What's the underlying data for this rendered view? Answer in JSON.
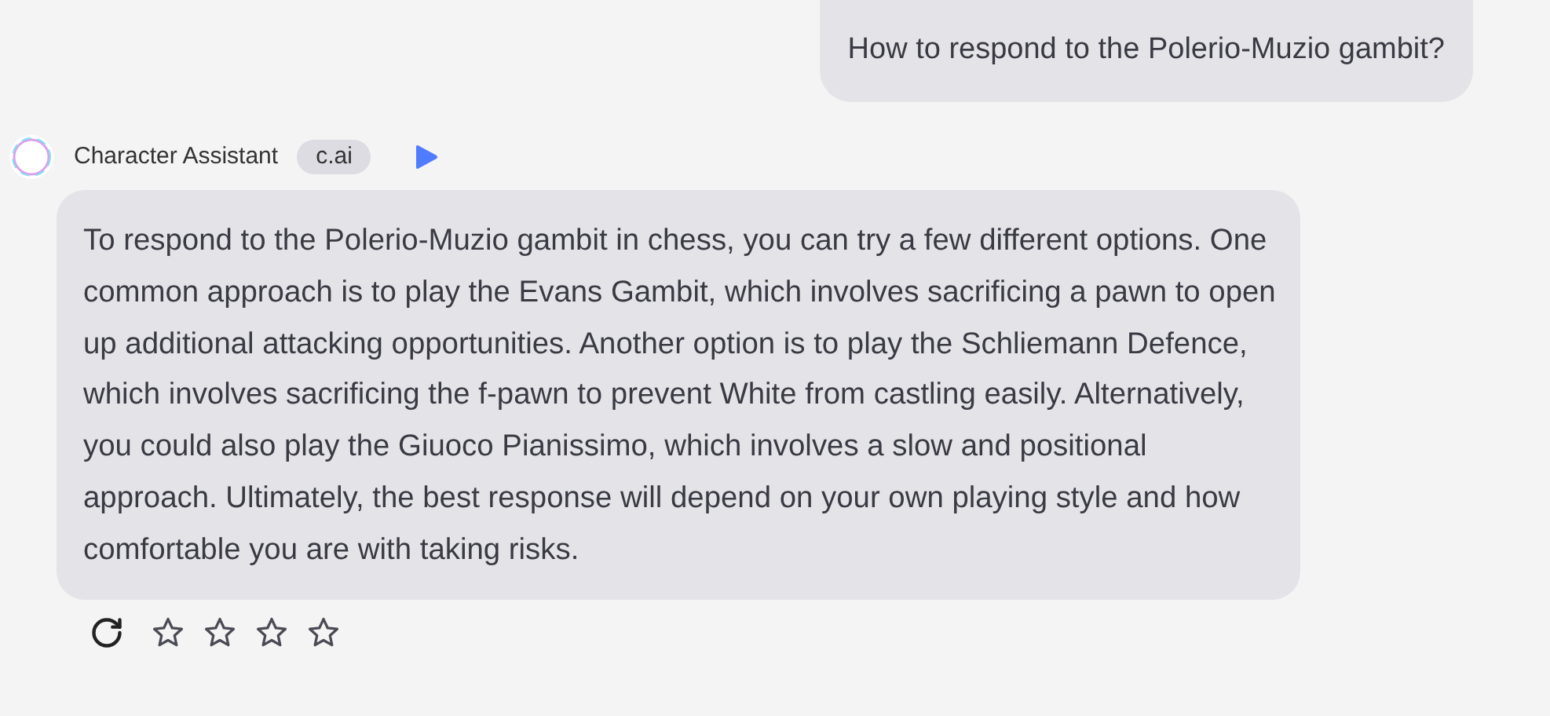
{
  "user_message": {
    "text": "How to respond to the Polerio-Muzio gambit?"
  },
  "reply": {
    "author": "Character Assistant",
    "badge": "c.ai",
    "text": "To respond to the Polerio-Muzio gambit in chess, you can try a few different options. One common approach is to play the Evans Gambit, which involves sacrificing a pawn to open up additional attacking opportunities. Another option is to play the Schliemann Defence, which involves sacrificing the f-pawn to prevent White from castling easily. Alternatively, you could also play the Giuoco Pianissimo, which involves a slow and positional approach. Ultimately, the best response will depend on your own playing style and how comfortable you are with taking risks.",
    "stars": 0
  }
}
